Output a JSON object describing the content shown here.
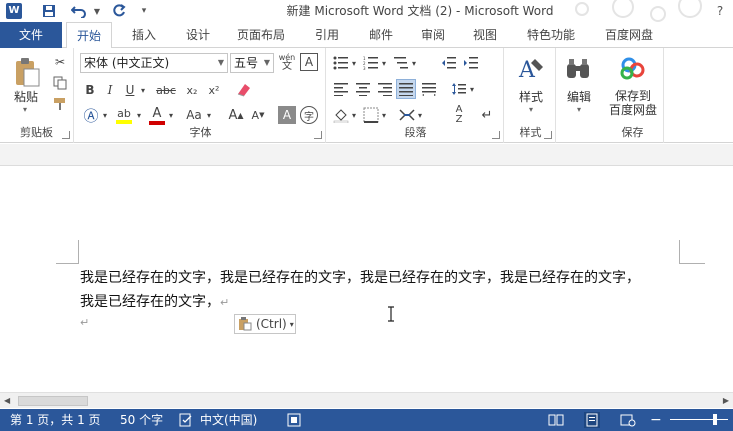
{
  "window": {
    "title": "新建 Microsoft Word 文档 (2) - Microsoft Word",
    "help": "?"
  },
  "tabs": [
    {
      "label": "文件"
    },
    {
      "label": "开始"
    },
    {
      "label": "插入"
    },
    {
      "label": "设计"
    },
    {
      "label": "页面布局"
    },
    {
      "label": "引用"
    },
    {
      "label": "邮件"
    },
    {
      "label": "审阅"
    },
    {
      "label": "视图"
    },
    {
      "label": "特色功能"
    },
    {
      "label": "百度网盘"
    }
  ],
  "ribbon": {
    "clipboard": {
      "paste": "粘贴",
      "label": "剪贴板"
    },
    "font": {
      "font_name": "宋体 (中文正文)",
      "font_size": "五号",
      "label": "字体",
      "wen": "wén"
    },
    "paragraph": {
      "label": "段落"
    },
    "styles": {
      "button": "样式",
      "label": "样式"
    },
    "editing": {
      "button": "编辑"
    },
    "save": {
      "button_line1": "保存到",
      "button_line2": "百度网盘",
      "label": "保存"
    }
  },
  "document": {
    "line1": "我是已经存在的文字，我是已经存在的文字，我是已经存在的文字，我是已经存在的文字，",
    "line2": "我是已经存在的文字，",
    "paste_options": "(Ctrl)"
  },
  "status": {
    "page": "第 1 页，共 1 页",
    "words": "50 个字",
    "language": "中文(中国)"
  },
  "colors": {
    "brand": "#2b579a",
    "highlight": "#ffff00",
    "font_color": "#d00000"
  }
}
